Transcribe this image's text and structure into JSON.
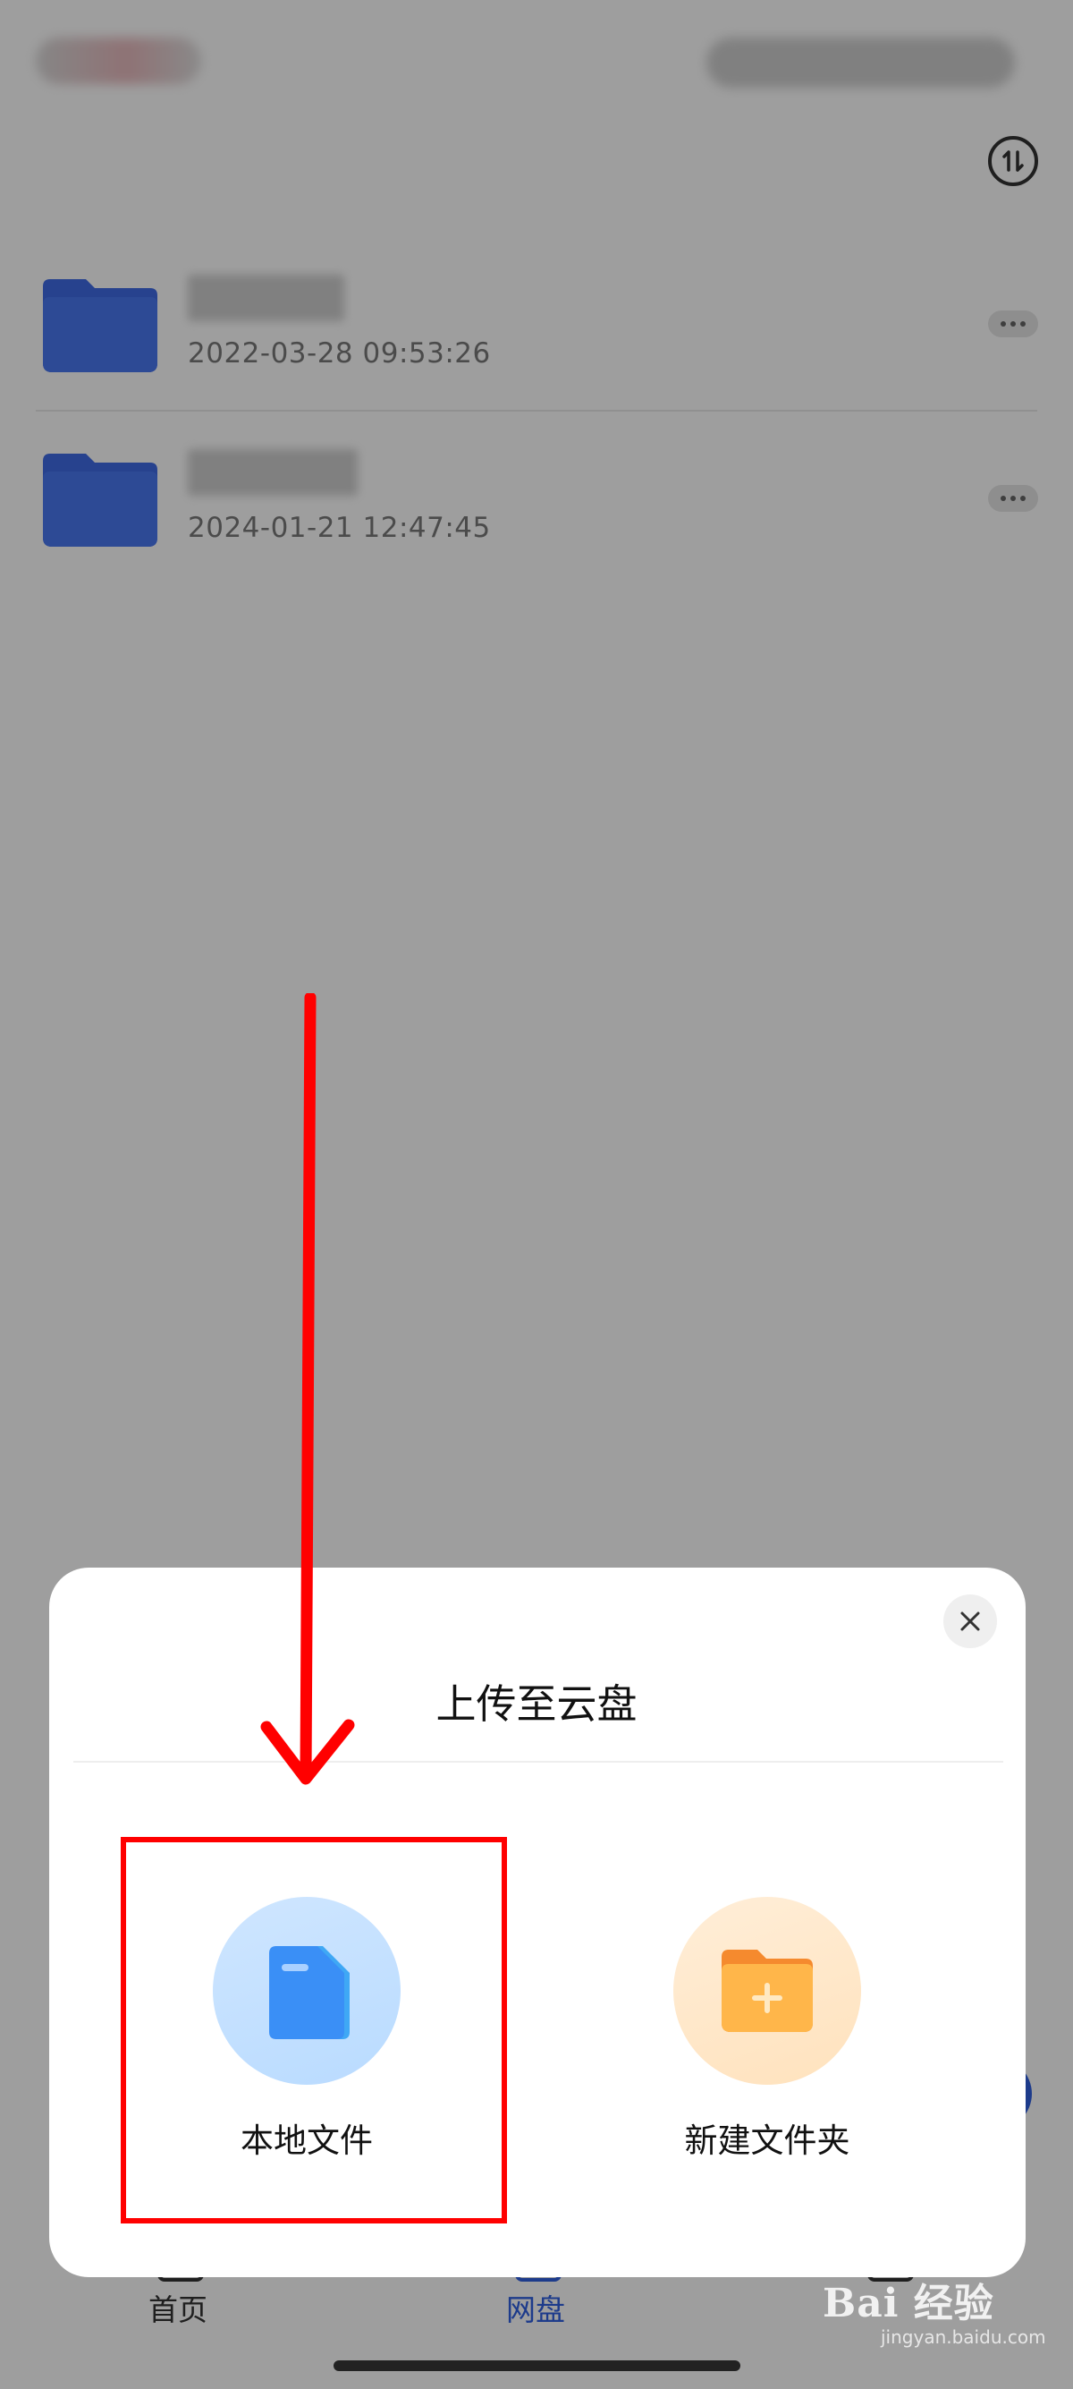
{
  "files": [
    {
      "date": "2022-03-28 09:53:26"
    },
    {
      "date": "2024-01-21 12:47:45"
    }
  ],
  "tabs": [
    {
      "label": "首页",
      "active": false
    },
    {
      "label": "网盘",
      "active": true
    }
  ],
  "sheet": {
    "title": "上传至云盘",
    "options": [
      {
        "label": "本地文件",
        "icon": "local-file-icon"
      },
      {
        "label": "新建文件夹",
        "icon": "new-folder-icon"
      }
    ]
  },
  "watermark": {
    "text": "Bai 经验",
    "sub": "jingyan.baidu.com"
  },
  "colors": {
    "accent": "#2f5fe0",
    "annotation": "#ff0000",
    "folder": "#4a78f0"
  }
}
